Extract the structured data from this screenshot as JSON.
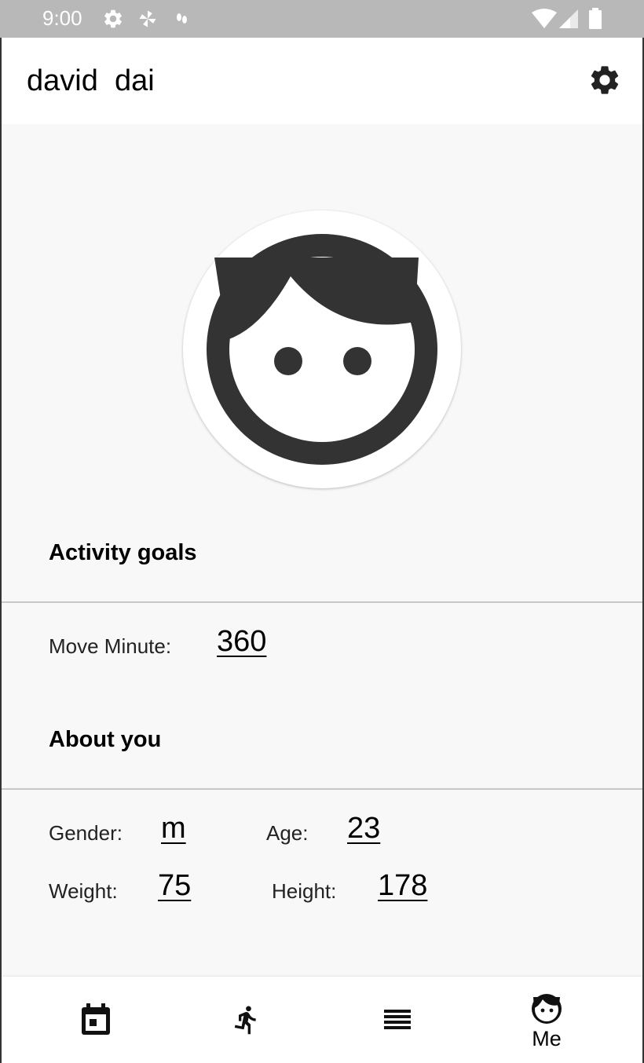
{
  "status_bar": {
    "time": "9:00",
    "left_icons": [
      "gear-icon",
      "pinwheel-icon",
      "footprint-icon"
    ],
    "right_icons": [
      "wifi-icon",
      "signal-icon",
      "battery-icon"
    ]
  },
  "header": {
    "title": "david  dai",
    "settings_icon": "gear-icon"
  },
  "profile": {
    "avatar_icon": "face-icon"
  },
  "activity_goals": {
    "title": "Activity goals",
    "move_minute_label": "Move Minute:",
    "move_minute_value": "360"
  },
  "about_you": {
    "title": "About you",
    "gender_label": "Gender:",
    "gender_value": "m",
    "age_label": "Age:",
    "age_value": "23",
    "weight_label": "Weight:",
    "weight_value": "75",
    "height_label": "Height:",
    "height_value": "178"
  },
  "bottom_nav": {
    "items": [
      {
        "icon": "calendar-icon",
        "label": ""
      },
      {
        "icon": "run-icon",
        "label": ""
      },
      {
        "icon": "list-icon",
        "label": ""
      },
      {
        "icon": "face-icon",
        "label": "Me",
        "selected": true
      }
    ]
  },
  "colors": {
    "status_bar": "#b8b8b8",
    "app_bar": "#ffffff",
    "content_bg": "#f8f8f8",
    "icon_dark": "#333333",
    "divider": "#c8c8c8"
  }
}
